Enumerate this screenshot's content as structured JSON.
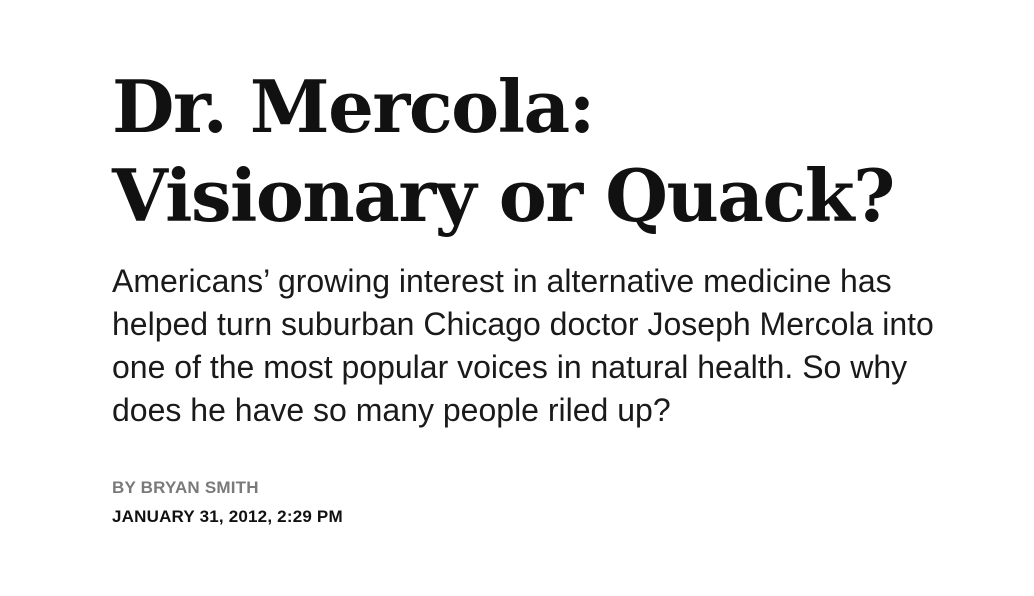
{
  "article": {
    "headline_line1": "Dr. Mercola:",
    "headline_line2": "Visionary or Quack?",
    "dek": "Americans’ growing interest in alternative medicine has helped turn suburban Chicago doctor Joseph Mercola into one of the most popular voices in natural health. So why does he have so many people riled up?",
    "byline_prefix": "BY",
    "author": "BRYAN SMITH",
    "date": "JANUARY 31, 2012, 2:29 PM"
  },
  "colors": {
    "headline": "#111111",
    "byline": "#7a7a7a",
    "date": "#111111"
  }
}
